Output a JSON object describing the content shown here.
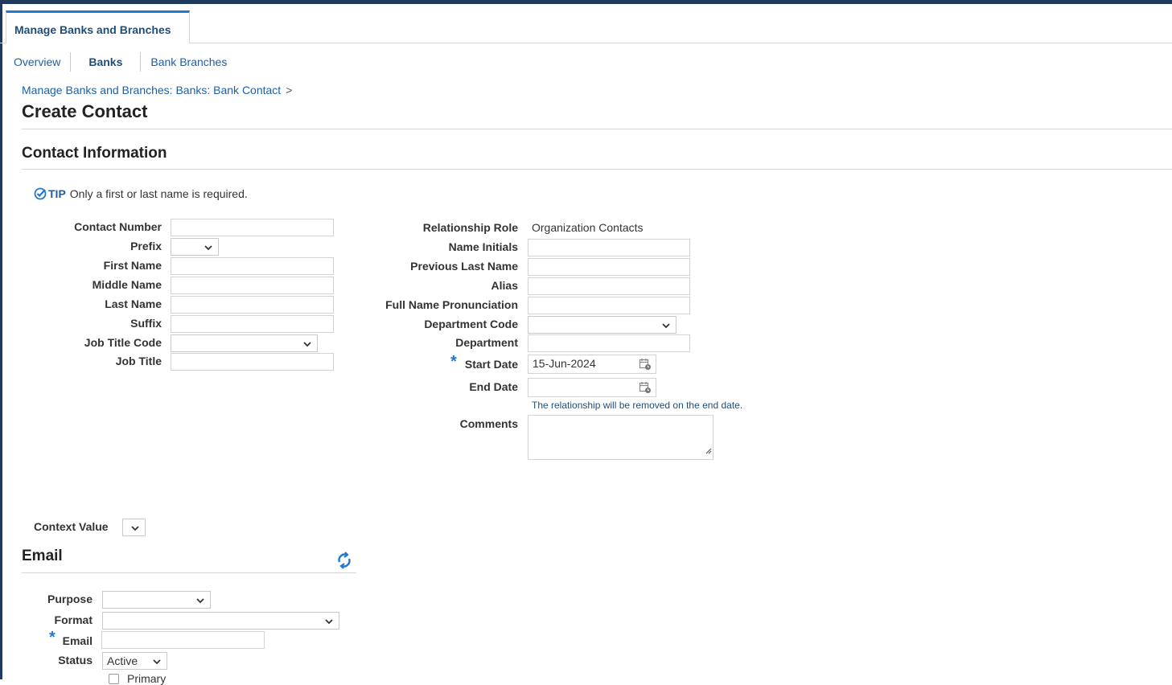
{
  "tabs": {
    "active": "Manage Banks and Branches"
  },
  "subnav": {
    "overview": "Overview",
    "banks": "Banks",
    "branches": "Bank Branches"
  },
  "breadcrumb": {
    "path": "Manage Banks and Branches: Banks: Bank Contact",
    "arrow": ">"
  },
  "page": {
    "title": "Create Contact",
    "section": "Contact Information"
  },
  "tip": {
    "label": "TIP",
    "text": "Only a first or last name is required."
  },
  "left_form": {
    "contact_number": {
      "label": "Contact Number",
      "value": ""
    },
    "prefix": {
      "label": "Prefix",
      "value": ""
    },
    "first_name": {
      "label": "First Name",
      "value": ""
    },
    "middle_name": {
      "label": "Middle Name",
      "value": ""
    },
    "last_name": {
      "label": "Last Name",
      "value": ""
    },
    "suffix": {
      "label": "Suffix",
      "value": ""
    },
    "job_title_code": {
      "label": "Job Title Code",
      "value": ""
    },
    "job_title": {
      "label": "Job Title",
      "value": ""
    }
  },
  "right_form": {
    "relationship_role": {
      "label": "Relationship Role",
      "value": "Organization Contacts"
    },
    "name_initials": {
      "label": "Name Initials",
      "value": ""
    },
    "previous_last_name": {
      "label": "Previous Last Name",
      "value": ""
    },
    "alias": {
      "label": "Alias",
      "value": ""
    },
    "full_name_pronunciation": {
      "label": "Full Name Pronunciation",
      "value": ""
    },
    "department_code": {
      "label": "Department Code",
      "value": ""
    },
    "department": {
      "label": "Department",
      "value": ""
    },
    "start_date": {
      "label": "Start Date",
      "value": "15-Jun-2024",
      "required_mark": "*"
    },
    "end_date": {
      "label": "End Date",
      "value": "",
      "note": "The relationship will be removed on the end date."
    },
    "comments": {
      "label": "Comments",
      "value": ""
    }
  },
  "context": {
    "label": "Context Value",
    "value": ""
  },
  "email": {
    "title": "Email",
    "purpose": {
      "label": "Purpose",
      "value": ""
    },
    "format": {
      "label": "Format",
      "value": ""
    },
    "email": {
      "label": "Email",
      "value": "",
      "required_mark": "*"
    },
    "status": {
      "label": "Status",
      "value": "Active"
    },
    "primary_label": "Primary"
  },
  "colors": {
    "accent": "#1f78d1",
    "brand": "#1f3a5a",
    "link": "#1f5fa6"
  },
  "icons": {
    "tip": "check-badge-icon",
    "calendar": "calendar-icon",
    "refresh": "refresh-icon",
    "dropdown": "chevron-down-icon"
  }
}
